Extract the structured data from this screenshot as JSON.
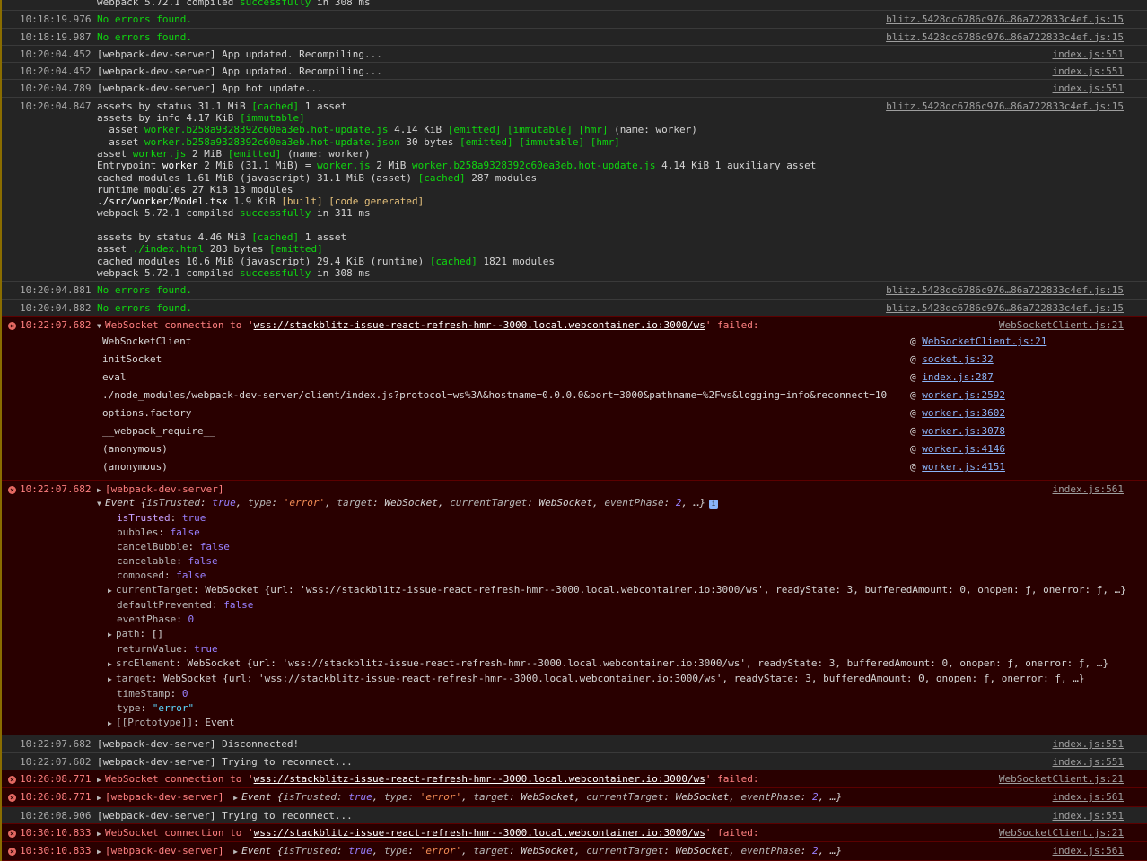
{
  "console": {
    "top_line": "webpack 5.72.1 compiled successfully in 368 ms",
    "src_blitz": "blitz.5428dc6786c976…86a722833c4ef.js:15",
    "src_index551": "index.js:551",
    "src_index561": "index.js:561",
    "src_wsclient": "WebSocketClient.js:21",
    "no_errors": "No errors found.",
    "app_updated": "[webpack-dev-server] App updated. Recompiling...",
    "hot_update": "[webpack-dev-server] App hot update...",
    "disconnected": "[webpack-dev-server] Disconnected!",
    "trying": "[webpack-dev-server] Trying to reconnect...",
    "ts": {
      "t1": "10:18:19.976",
      "t2": "10:18:19.987",
      "t3": "10:20:04.452",
      "t4": "10:20:04.452",
      "t5": "10:20:04.789",
      "t6": "10:20:04.847",
      "t7": "10:20:04.881",
      "t8": "10:20:04.882",
      "t9": "10:22:07.682",
      "t10": "10:22:07.682",
      "t11": "10:22:07.682",
      "t12": "10:22:07.682",
      "t13": "10:26:08.771",
      "t14": "10:26:08.771",
      "t15": "10:26:08.906",
      "t16": "10:30:10.833",
      "t17": "10:30:10.833"
    },
    "build": {
      "l1a": "assets by status 31.1 MiB ",
      "l1b": "[cached]",
      "l1c": " 1 asset",
      "l2a": "assets by info 4.17 KiB ",
      "l2b": "[immutable]",
      "l3a": "  asset ",
      "l3b": "worker.b258a9328392c60ea3eb.hot-update.js",
      "l3c": " 4.14 KiB ",
      "l3d": "[emitted] [immutable] [hmr]",
      "l3e": " (name: worker)",
      "l4a": "  asset ",
      "l4b": "worker.b258a9328392c60ea3eb.hot-update.json",
      "l4c": " 30 bytes ",
      "l4d": "[emitted] [immutable] [hmr]",
      "l5a": "asset ",
      "l5b": "worker.js",
      "l5c": " 2 MiB ",
      "l5d": "[emitted]",
      "l5e": " (name: worker)",
      "l6a": "Entrypoint ",
      "l6b": "worker",
      "l6c": " 2 MiB (31.1 MiB) = ",
      "l6d": "worker.js",
      "l6e": " 2 MiB ",
      "l6f": "worker.b258a9328392c60ea3eb.hot-update.js",
      "l6g": " 4.14 KiB 1 auxiliary asset",
      "l7a": "cached modules 1.61 MiB (javascript) 31.1 MiB (asset) ",
      "l7b": "[cached]",
      "l7c": " 287 modules",
      "l8": "runtime modules 27 KiB 13 modules",
      "l9a": "./src/worker/Model.tsx",
      "l9b": " 1.9 KiB ",
      "l9c": "[built] [code generated]",
      "l10a": "webpack 5.72.1 compiled ",
      "l10b": "successfully",
      "l10c": " in 311 ms",
      "l11a": "assets by status 4.46 MiB ",
      "l11b": "[cached]",
      "l11c": " 1 asset",
      "l12a": "asset ",
      "l12b": "./index.html",
      "l12c": " 283 bytes ",
      "l12d": "[emitted]",
      "l13a": "cached modules 10.6 MiB (javascript) 29.4 KiB (runtime) ",
      "l13b": "[cached]",
      "l13c": " 1821 modules",
      "l14a": "webpack 5.72.1 compiled ",
      "l14b": "successfully",
      "l14c": " in 308 ms"
    },
    "ws_error": {
      "pre": "WebSocket connection to '",
      "url": "wss://stackblitz-issue-react-refresh-hmr--3000.local.webcontainer.io:3000/ws",
      "post": "' failed:"
    },
    "stack": [
      {
        "fn": "WebSocketClient",
        "src": "WebSocketClient.js:21"
      },
      {
        "fn": "initSocket",
        "src": "socket.js:32"
      },
      {
        "fn": "eval",
        "src": "index.js:287"
      },
      {
        "fn": "./node_modules/webpack-dev-server/client/index.js?protocol=ws%3A&hostname=0.0.0.0&port=3000&pathname=%2Fws&logging=info&reconnect=10",
        "src": "worker.js:2592"
      },
      {
        "fn": "options.factory",
        "src": "worker.js:3602"
      },
      {
        "fn": "__webpack_require__",
        "src": "worker.js:3078"
      },
      {
        "fn": "(anonymous)",
        "src": "worker.js:4146"
      },
      {
        "fn": "(anonymous)",
        "src": "worker.js:4151"
      }
    ],
    "wds_label": "[webpack-dev-server]",
    "event_summary": {
      "a": "Event {",
      "k1": "isTrusted",
      "v1": "true",
      "k2": "type",
      "v2": "'error'",
      "k3": "target",
      "v3": "WebSocket",
      "k4": "currentTarget",
      "v4": "WebSocket",
      "k5": "eventPhase",
      "v5": "2",
      "end": ", …}"
    },
    "event_props": {
      "isTrusted": "true",
      "bubbles": "false",
      "cancelBubble": "false",
      "cancelable": "false",
      "composed": "false",
      "currentTarget": "WebSocket {url: 'wss://stackblitz-issue-react-refresh-hmr--3000.local.webcontainer.io:3000/ws', readyState: 3, bufferedAmount: 0, onopen: ƒ, onerror: ƒ, …}",
      "defaultPrevented": "false",
      "eventPhase": "0",
      "path": "[]",
      "returnValue": "true",
      "srcElement": "WebSocket {url: 'wss://stackblitz-issue-react-refresh-hmr--3000.local.webcontainer.io:3000/ws', readyState: 3, bufferedAmount: 0, onopen: ƒ, onerror: ƒ, …}",
      "target": "WebSocket {url: 'wss://stackblitz-issue-react-refresh-hmr--3000.local.webcontainer.io:3000/ws', readyState: 3, bufferedAmount: 0, onopen: ƒ, onerror: ƒ, …}",
      "timeStamp": "0",
      "type": "\"error\"",
      "proto": "Event"
    },
    "prop_labels": {
      "isTrusted": "isTrusted",
      "bubbles": "bubbles",
      "cancelBubble": "cancelBubble",
      "cancelable": "cancelable",
      "composed": "composed",
      "currentTarget": "currentTarget",
      "defaultPrevented": "defaultPrevented",
      "eventPhase": "eventPhase",
      "path": "path",
      "returnValue": "returnValue",
      "srcElement": "srcElement",
      "target": "target",
      "timeStamp": "timeStamp",
      "type": "type",
      "proto": "[[Prototype]]"
    },
    "colors": {
      "error_bg": "#290000",
      "error_text": "#ff8080",
      "success": "#0fd60f",
      "bg": "#242424"
    }
  }
}
